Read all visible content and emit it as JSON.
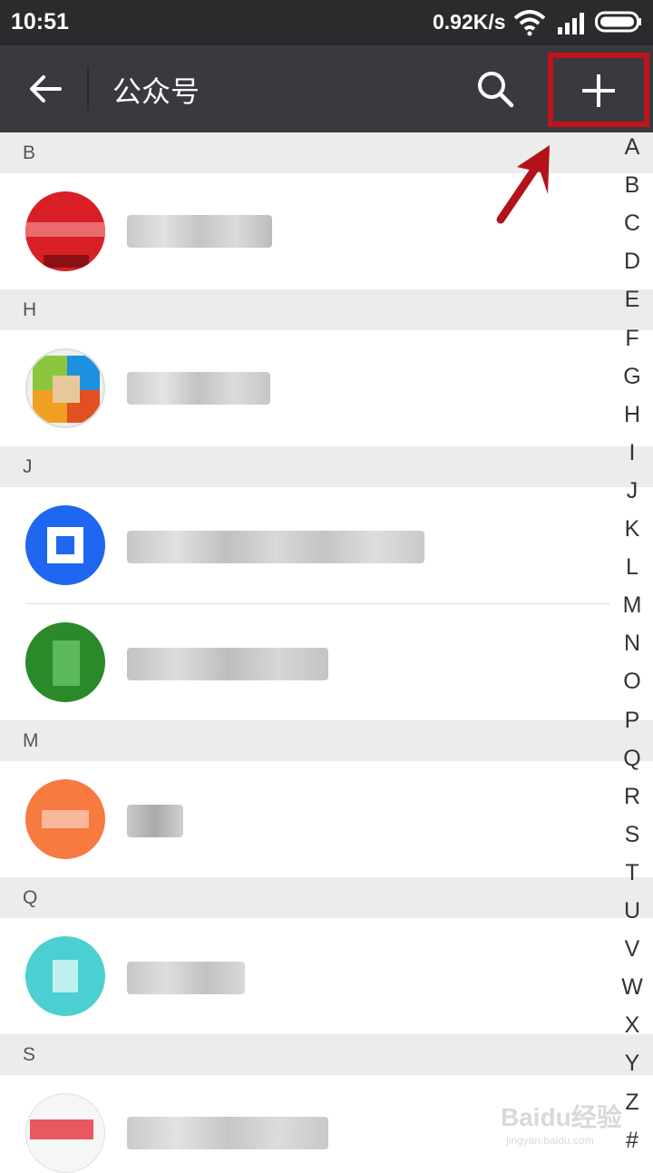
{
  "status_bar": {
    "time": "10:51",
    "network_speed": "0.92K/s",
    "icons": [
      "wifi-icon",
      "signal-icon",
      "battery-icon"
    ]
  },
  "app_bar": {
    "title": "公众号",
    "back_icon": "back-arrow-icon",
    "search_icon": "search-icon",
    "add_icon": "plus-icon",
    "highlight_color": "#c0141c"
  },
  "sections": [
    {
      "letter": "B"
    },
    {
      "letter": "H"
    },
    {
      "letter": "J"
    },
    {
      "letter": "M"
    },
    {
      "letter": "Q"
    },
    {
      "letter": "S"
    }
  ],
  "index_letters": [
    "A",
    "B",
    "C",
    "D",
    "E",
    "F",
    "G",
    "H",
    "I",
    "J",
    "K",
    "L",
    "M",
    "N",
    "O",
    "P",
    "Q",
    "R",
    "S",
    "T",
    "U",
    "V",
    "W",
    "X",
    "Y",
    "Z",
    "#"
  ],
  "colors": {
    "status_bar": "#2b2b2e",
    "app_bar": "#393a3f",
    "section_header": "#ececec",
    "annotation": "#b3121a",
    "avatars": [
      "#d81f26",
      "#e0a040",
      "#1f66f0",
      "#2a8a2a",
      "#f77a40",
      "#4ccfd0",
      "#f4c5c8"
    ]
  },
  "watermark": {
    "brand": "Baidu经验",
    "url": "jingyan.baidu.com"
  }
}
